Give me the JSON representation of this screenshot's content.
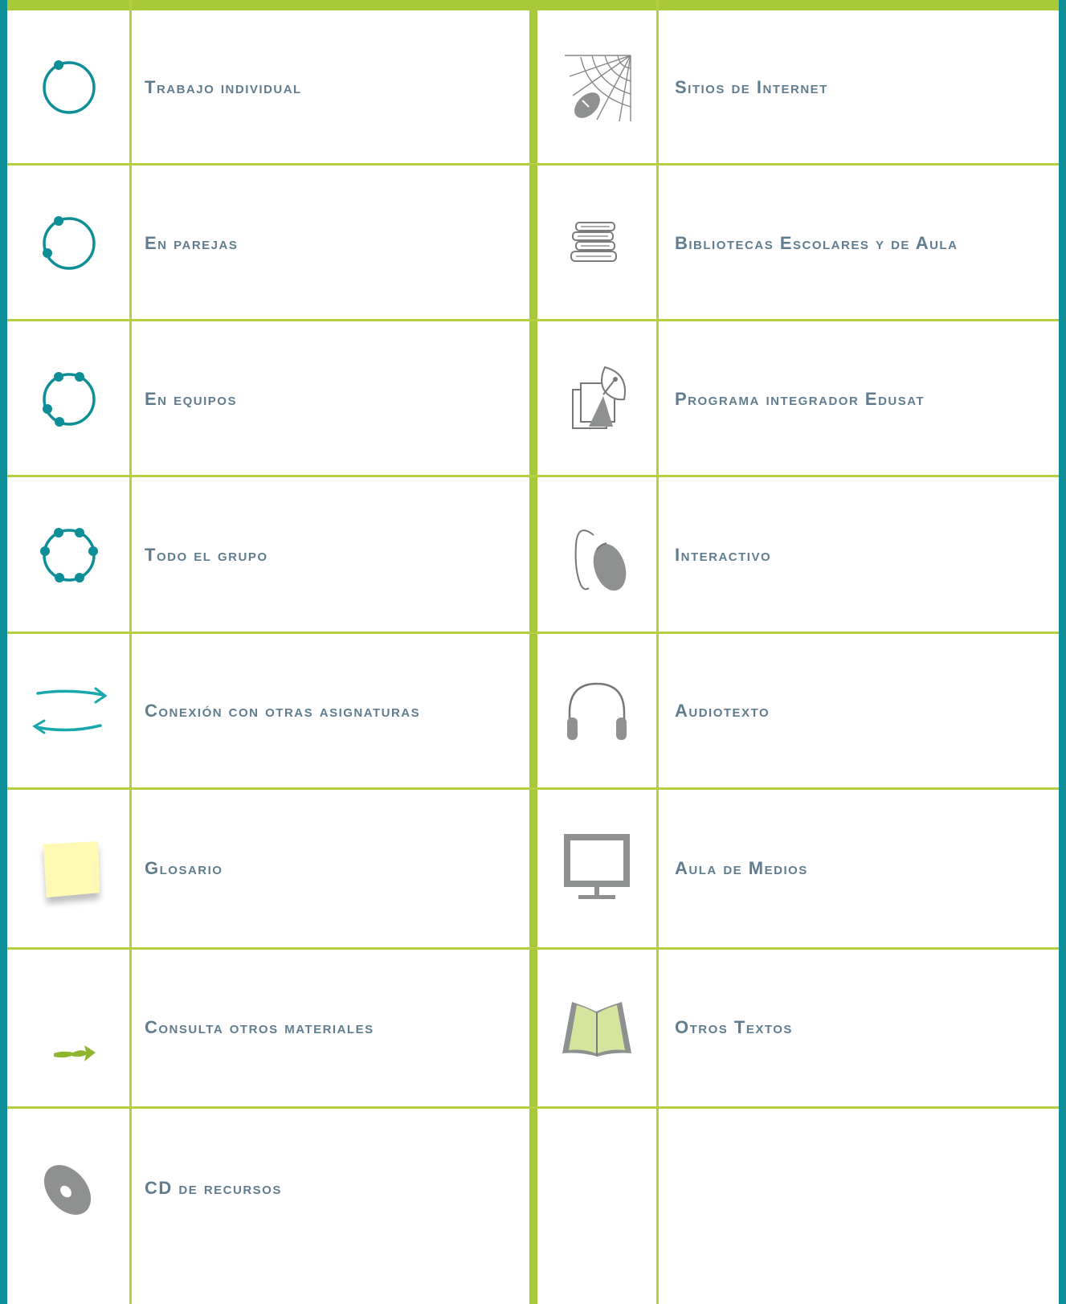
{
  "colors": {
    "teal": "#0e8f97",
    "lime": "#a8c93a",
    "label": "#5f7d8e",
    "gray_icon": "#9b9b9b"
  },
  "left_column": [
    {
      "label": "Trabajo individual",
      "icon": "circle-one-dot-icon"
    },
    {
      "label": "En parejas",
      "icon": "circle-two-dots-icon"
    },
    {
      "label": "En equipos",
      "icon": "circle-four-dots-icon"
    },
    {
      "label": "Todo el grupo",
      "icon": "circle-six-dots-icon"
    },
    {
      "label": "Conexión con otras asignaturas",
      "icon": "exchange-arrows-icon"
    },
    {
      "label": "Glosario",
      "icon": "sticky-note-icon"
    },
    {
      "label": "Consulta otros materiales",
      "icon": "green-arrow-icon"
    },
    {
      "label": "CD de recursos",
      "icon": "cd-disc-icon"
    }
  ],
  "right_column": [
    {
      "label": "Sitios de Internet",
      "icon": "web-mouse-icon"
    },
    {
      "label": "Bibliotecas Escolares y de Aula",
      "icon": "book-stack-icon"
    },
    {
      "label": "Programa integrador Edusat",
      "icon": "satellite-tv-icon"
    },
    {
      "label": "Interactivo",
      "icon": "mouse-icon"
    },
    {
      "label": "Audiotexto",
      "icon": "headphones-icon"
    },
    {
      "label": "Aula de Medios",
      "icon": "monitor-icon"
    },
    {
      "label": "Otros Textos",
      "icon": "open-book-icon"
    },
    {
      "label": "",
      "icon": ""
    }
  ]
}
